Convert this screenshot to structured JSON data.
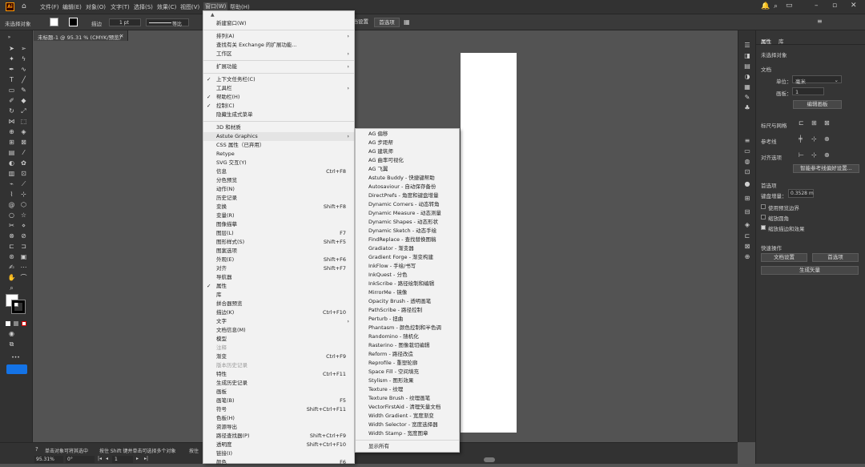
{
  "app": {
    "logo": "Ai"
  },
  "menubar": {
    "items": [
      "文件(F)",
      "编辑(E)",
      "对象(O)",
      "文字(T)",
      "选择(S)",
      "效果(C)",
      "视图(V)",
      "窗口(W)",
      "帮助(H)"
    ]
  },
  "controlbar": {
    "no_selection": "未选择对象",
    "stroke_label": "描边",
    "stroke_value": "1 pt",
    "stroke_style": "等比",
    "doc_settings": "文档设置",
    "preferences": "首选项"
  },
  "document": {
    "tab_title": "未标题-1 @ 95.31 % (CMYK/预览)"
  },
  "statusbar": {
    "hint1": "单击对象可将其选中",
    "hint2": "按住 Shift 键并单击可选择多个对象",
    "hint3": "按住",
    "zoom": "95.31%",
    "rotate": "0°",
    "page": "1"
  },
  "window_menu": {
    "items": [
      {
        "label": "新建窗口(W)",
        "shortcut": "",
        "arrow": false,
        "checked": false,
        "disabled": false
      },
      {
        "sep": true
      },
      {
        "label": "排列(A)",
        "shortcut": "",
        "arrow": true,
        "checked": false,
        "disabled": false
      },
      {
        "label": "查找有关 Exchange 的扩展功能...",
        "shortcut": "",
        "arrow": false,
        "checked": false,
        "disabled": false
      },
      {
        "label": "工作区",
        "shortcut": "",
        "arrow": true,
        "checked": false,
        "disabled": false
      },
      {
        "sep": true
      },
      {
        "label": "扩展功能",
        "shortcut": "",
        "arrow": true,
        "checked": false,
        "disabled": false
      },
      {
        "sep": true
      },
      {
        "label": "上下文任务栏(C)",
        "shortcut": "",
        "arrow": false,
        "checked": true,
        "disabled": false
      },
      {
        "label": "工具栏",
        "shortcut": "",
        "arrow": true,
        "checked": false,
        "disabled": false
      },
      {
        "label": "帮助栏(H)",
        "shortcut": "",
        "arrow": false,
        "checked": true,
        "disabled": false
      },
      {
        "label": "控制(C)",
        "shortcut": "",
        "arrow": false,
        "checked": true,
        "disabled": false
      },
      {
        "label": "隐藏生成式菜单",
        "shortcut": "",
        "arrow": false,
        "checked": false,
        "disabled": false
      },
      {
        "sep": true
      },
      {
        "label": "3D 和材质",
        "shortcut": "",
        "arrow": false,
        "checked": false,
        "disabled": false
      },
      {
        "label": "Astute Graphics",
        "shortcut": "",
        "arrow": true,
        "checked": false,
        "disabled": false,
        "highlight": true
      },
      {
        "label": "CSS 属性（已弃用）",
        "shortcut": "",
        "arrow": false,
        "checked": false,
        "disabled": false
      },
      {
        "label": "Retype",
        "shortcut": "",
        "arrow": false,
        "checked": false,
        "disabled": false
      },
      {
        "label": "SVG 交互(Y)",
        "shortcut": "",
        "arrow": false,
        "checked": false,
        "disabled": false
      },
      {
        "label": "信息",
        "shortcut": "Ctrl+F8",
        "arrow": false,
        "checked": false,
        "disabled": false
      },
      {
        "label": "分色预览",
        "shortcut": "",
        "arrow": false,
        "checked": false,
        "disabled": false
      },
      {
        "label": "动作(N)",
        "shortcut": "",
        "arrow": false,
        "checked": false,
        "disabled": false
      },
      {
        "label": "历史记录",
        "shortcut": "",
        "arrow": false,
        "checked": false,
        "disabled": false
      },
      {
        "label": "变换",
        "shortcut": "Shift+F8",
        "arrow": false,
        "checked": false,
        "disabled": false
      },
      {
        "label": "变量(R)",
        "shortcut": "",
        "arrow": false,
        "checked": false,
        "disabled": false
      },
      {
        "label": "图像描摹",
        "shortcut": "",
        "arrow": false,
        "checked": false,
        "disabled": false
      },
      {
        "label": "图层(L)",
        "shortcut": "F7",
        "arrow": false,
        "checked": false,
        "disabled": false
      },
      {
        "label": "图形样式(S)",
        "shortcut": "Shift+F5",
        "arrow": false,
        "checked": false,
        "disabled": false
      },
      {
        "label": "图案选项",
        "shortcut": "",
        "arrow": false,
        "checked": false,
        "disabled": false
      },
      {
        "label": "外观(E)",
        "shortcut": "Shift+F6",
        "arrow": false,
        "checked": false,
        "disabled": false
      },
      {
        "label": "对齐",
        "shortcut": "Shift+F7",
        "arrow": false,
        "checked": false,
        "disabled": false
      },
      {
        "label": "导航器",
        "shortcut": "",
        "arrow": false,
        "checked": false,
        "disabled": false
      },
      {
        "label": "属性",
        "shortcut": "",
        "arrow": false,
        "checked": true,
        "disabled": false
      },
      {
        "label": "库",
        "shortcut": "",
        "arrow": false,
        "checked": false,
        "disabled": false
      },
      {
        "label": "拼合器预览",
        "shortcut": "",
        "arrow": false,
        "checked": false,
        "disabled": false
      },
      {
        "label": "描边(K)",
        "shortcut": "Ctrl+F10",
        "arrow": false,
        "checked": false,
        "disabled": false
      },
      {
        "label": "文字",
        "shortcut": "",
        "arrow": true,
        "checked": false,
        "disabled": false
      },
      {
        "label": "文档信息(M)",
        "shortcut": "",
        "arrow": false,
        "checked": false,
        "disabled": false
      },
      {
        "label": "模型",
        "shortcut": "",
        "arrow": false,
        "checked": false,
        "disabled": false
      },
      {
        "label": "注释",
        "shortcut": "",
        "arrow": false,
        "checked": false,
        "disabled": true
      },
      {
        "label": "渐变",
        "shortcut": "Ctrl+F9",
        "arrow": false,
        "checked": false,
        "disabled": false
      },
      {
        "label": "版本历史记录",
        "shortcut": "",
        "arrow": false,
        "checked": false,
        "disabled": true
      },
      {
        "label": "特性",
        "shortcut": "Ctrl+F11",
        "arrow": false,
        "checked": false,
        "disabled": false
      },
      {
        "label": "生成历史记录",
        "shortcut": "",
        "arrow": false,
        "checked": false,
        "disabled": false
      },
      {
        "label": "画板",
        "shortcut": "",
        "arrow": false,
        "checked": false,
        "disabled": false
      },
      {
        "label": "画笔(B)",
        "shortcut": "F5",
        "arrow": false,
        "checked": false,
        "disabled": false
      },
      {
        "label": "符号",
        "shortcut": "Shift+Ctrl+F11",
        "arrow": false,
        "checked": false,
        "disabled": false
      },
      {
        "label": "色板(H)",
        "shortcut": "",
        "arrow": false,
        "checked": false,
        "disabled": false
      },
      {
        "label": "资源导出",
        "shortcut": "",
        "arrow": false,
        "checked": false,
        "disabled": false
      },
      {
        "label": "路径查找器(P)",
        "shortcut": "Shift+Ctrl+F9",
        "arrow": false,
        "checked": false,
        "disabled": false
      },
      {
        "label": "透明度",
        "shortcut": "Shift+Ctrl+F10",
        "arrow": false,
        "checked": false,
        "disabled": false
      },
      {
        "label": "链接(I)",
        "shortcut": "",
        "arrow": false,
        "checked": false,
        "disabled": false
      },
      {
        "label": "颜色",
        "shortcut": "F6",
        "arrow": false,
        "checked": false,
        "disabled": false
      }
    ]
  },
  "astute_submenu": {
    "items": [
      "AG 偏移",
      "AG 步距帮",
      "AG 建筑师",
      "AG 曲率可视化",
      "AG 飞翼",
      "Astute Buddy - 快捷键帮助",
      "Autosaviour - 自动保存备份",
      "DirectPrefs - 角度和键盘增量",
      "Dynamic Corners - 动态转角",
      "Dynamic Measure - 动态测量",
      "Dynamic Shapes - 动态形状",
      "Dynamic Sketch - 动态手绘",
      "FindReplace - 查找替换图稿",
      "Gradiator - 渐变器",
      "Gradient Forge - 渐变构建",
      "InkFlow - 手绘/书写",
      "InkQuest - 分色",
      "InkScribe - 路径绘制和编辑",
      "MirrorMe - 镜像",
      "Opacity Brush - 透明画笔",
      "PathScribe - 路径控制",
      "Perturb - 扭曲",
      "Phantasm - 颜色控制和半色调",
      "Randomino - 随机化",
      "Rasterino - 图像栽切编辑",
      "Reform - 路径改造",
      "Reprofile - 重塑轮廓",
      "Space Fill - 空间填充",
      "Stylism - 图形效果",
      "Texture - 纹理",
      "Texture Brush - 纹理画笔",
      "VectorFirstAid - 清理矢量文档",
      "Width Gradient - 宽度渐变",
      "Width Selector - 宽度选择器",
      "Width Stamp - 宽度图章",
      "显示所有"
    ]
  },
  "properties_panel": {
    "tab_properties": "属性",
    "tab_library": "库",
    "no_selection": "未选择对象",
    "document_section": "文档",
    "units_label": "单位：",
    "units_value": "毫米",
    "artboard_label": "画板：",
    "artboard_value": "1",
    "edit_artboard": "编辑画板",
    "rulers_grids": "标尺与网格",
    "guides": "参考线",
    "snap_options": "对齐选项",
    "smart_guides_btn": "智能参考线偏好设置...",
    "preferences_section": "首选项",
    "keyboard_increment_label": "键盘增量：",
    "keyboard_increment_value": "0.3528 m",
    "use_preview_bounds": "使用预览边界",
    "scale_corners": "缩放圆角",
    "scale_strokes": "缩放描边和效果",
    "quick_actions": "快速操作",
    "doc_settings_btn": "文档设置",
    "preferences_btn": "首选项",
    "vectorize_btn": "生成矢量"
  }
}
